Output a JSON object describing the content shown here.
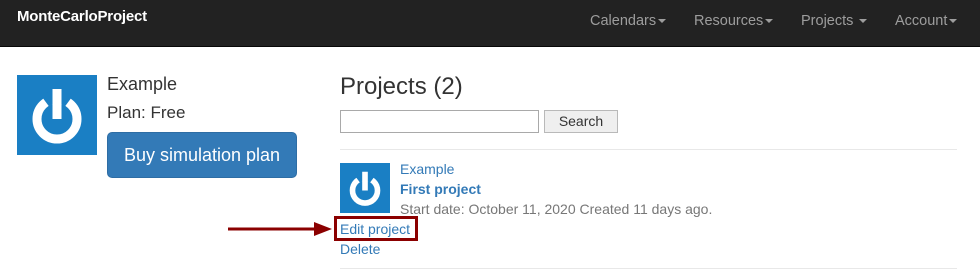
{
  "navbar": {
    "brand": "MonteCarloProject",
    "items": [
      {
        "label": "Calendars"
      },
      {
        "label": "Resources"
      },
      {
        "label": "Projects"
      },
      {
        "label": "Account"
      }
    ]
  },
  "profile": {
    "name": "Example",
    "plan": "Plan: Free",
    "buy_button": "Buy simulation plan",
    "avatar_icon": "power-logo-icon"
  },
  "projects": {
    "title": "Projects (2)",
    "search": {
      "value": "",
      "button_label": "Search"
    },
    "items": [
      {
        "owner": "Example",
        "name": "First project",
        "meta": "Start date: October 11, 2020 Created 11 days ago.",
        "edit_label": "Edit project",
        "delete_label": "Delete",
        "thumb_icon": "power-logo-icon"
      }
    ]
  },
  "colors": {
    "navbar_bg": "#222222",
    "nav_text": "#9d9d9d",
    "primary": "#337ab7",
    "logo_blue": "#1a7fc4",
    "annotation": "#8b0000"
  }
}
